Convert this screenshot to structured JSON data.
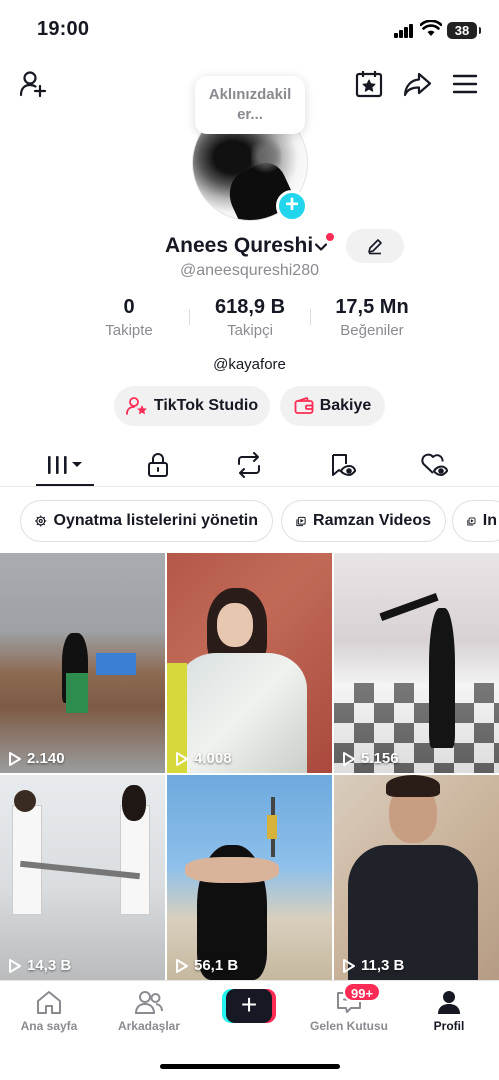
{
  "status_bar": {
    "time": "19:00",
    "battery": "38"
  },
  "profile": {
    "note_bubble": "Aklınızdakil er...",
    "name": "Anees Qureshi",
    "handle": "@aneesqureshi280",
    "link": "@kayafore"
  },
  "stats": [
    {
      "value": "0",
      "label": "Takipte"
    },
    {
      "value": "618,9 B",
      "label": "Takipçi"
    },
    {
      "value": "17,5 Mn",
      "label": "Beğeniler"
    }
  ],
  "buttons": {
    "studio": "TikTok Studio",
    "balance": "Bakiye"
  },
  "chips": [
    {
      "label": "Oynatma listelerini yönetin"
    },
    {
      "label": "Ramzan Videos"
    },
    {
      "label": "In"
    }
  ],
  "videos": [
    {
      "views": "2.140"
    },
    {
      "views": "4.008"
    },
    {
      "views": "5.156"
    },
    {
      "views": "14,3 B"
    },
    {
      "views": "56,1 B"
    },
    {
      "views": "11,3 B"
    }
  ],
  "nav": {
    "home": "Ana sayfa",
    "friends": "Arkadaşlar",
    "create": "+",
    "inbox": "Gelen Kutusu",
    "inbox_badge": "99+",
    "profile": "Profil"
  },
  "colors": {
    "accent": "#fe2c55",
    "cyan": "#20d5ec",
    "text": "#161823",
    "muted": "#8a8b91"
  }
}
